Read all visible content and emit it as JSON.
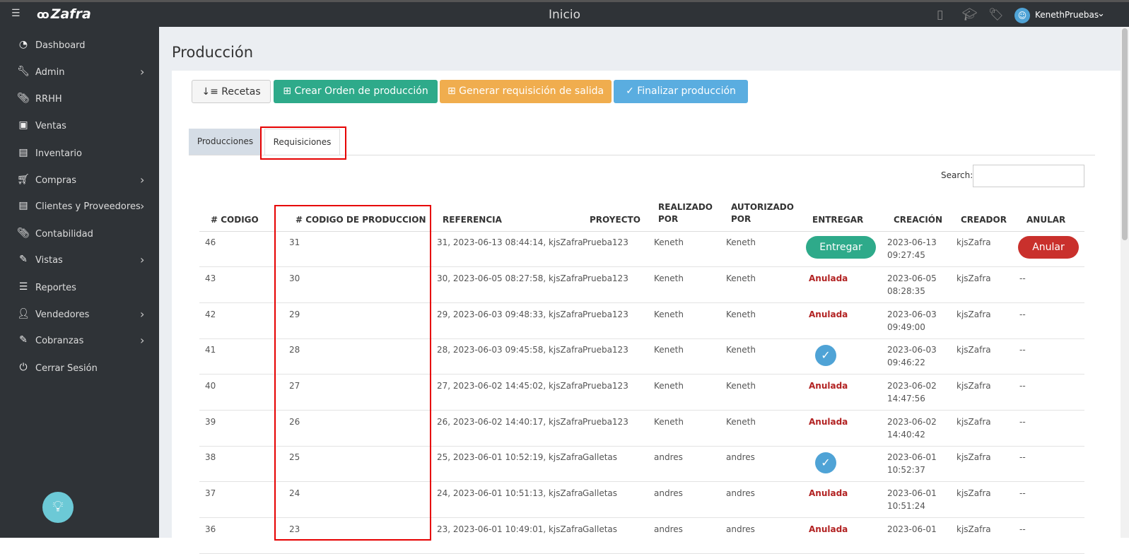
{
  "topbar": {
    "menu_icon": "menu-icon",
    "brand": "Zafra",
    "title": "Inicio",
    "icons": [
      "mobile-icon",
      "graduation-cap-icon",
      "tags-icon"
    ],
    "username": "KenethPruebas"
  },
  "sidebar": {
    "items": [
      {
        "label": "Dashboard",
        "icon": "dashboard-icon",
        "has_submenu": false
      },
      {
        "label": "Admin",
        "icon": "wrench-icon",
        "has_submenu": true
      },
      {
        "label": "RRHH",
        "icon": "paperclip-icon",
        "has_submenu": false
      },
      {
        "label": "Ventas",
        "icon": "money-icon",
        "has_submenu": false
      },
      {
        "label": "Inventario",
        "icon": "book-icon",
        "has_submenu": false
      },
      {
        "label": "Compras",
        "icon": "cart-icon",
        "has_submenu": true
      },
      {
        "label": "Clientes y Proveedores",
        "icon": "book-icon",
        "has_submenu": true
      },
      {
        "label": "Contabilidad",
        "icon": "paperclip-icon",
        "has_submenu": false
      },
      {
        "label": "Vistas",
        "icon": "edit-icon",
        "has_submenu": true
      },
      {
        "label": "Reportes",
        "icon": "list-icon",
        "has_submenu": false
      },
      {
        "label": "Vendedores",
        "icon": "user-icon",
        "has_submenu": true
      },
      {
        "label": "Cobranzas",
        "icon": "edit-icon",
        "has_submenu": true
      },
      {
        "label": "Cerrar Sesión",
        "icon": "power-icon",
        "has_submenu": false
      }
    ]
  },
  "page": {
    "title": "Producción"
  },
  "toolbar": {
    "recetas": "Recetas",
    "crear": "Crear Orden de producción",
    "generar": "Generar requisición de salida",
    "finalizar": "Finalizar producción"
  },
  "tabs": {
    "producciones": "Producciones",
    "requisiciones": "Requisiciones",
    "active": "Requisiciones"
  },
  "search": {
    "label": "Search:",
    "value": ""
  },
  "table": {
    "headers": {
      "codigo": "# CODIGO",
      "codigo_produccion": "# CODIGO DE PRODUCCION",
      "referencia": "REFERENCIA",
      "proyecto": "PROYECTO",
      "realizado_1": "REALIZADO",
      "realizado_2": "POR",
      "autorizado_1": "AUTORIZADO",
      "autorizado_2": "POR",
      "entregar": "ENTREGAR",
      "creacion": "CREACIÓN",
      "creador": "CREADOR",
      "anular": "ANULAR"
    },
    "rows": [
      {
        "codigo": "46",
        "cod_prod": "31",
        "referencia": "31, 2023-06-13 08:44:14, kjsZafra",
        "proyecto": "Prueba123",
        "realizado": "Keneth",
        "autorizado": "Keneth",
        "entregar_type": "button",
        "entregar": "Entregar",
        "fecha": "2023-06-13",
        "hora": "09:27:45",
        "creador": "kjsZafra",
        "anular_type": "button",
        "anular": "Anular"
      },
      {
        "codigo": "43",
        "cod_prod": "30",
        "referencia": "30, 2023-06-05 08:27:58, kjsZafra",
        "proyecto": "Prueba123",
        "realizado": "Keneth",
        "autorizado": "Keneth",
        "entregar_type": "text",
        "entregar": "Anulada",
        "fecha": "2023-06-05",
        "hora": "08:28:35",
        "creador": "kjsZafra",
        "anular_type": "text",
        "anular": "--"
      },
      {
        "codigo": "42",
        "cod_prod": "29",
        "referencia": "29, 2023-06-03 09:48:33, kjsZafra",
        "proyecto": "Prueba123",
        "realizado": "Keneth",
        "autorizado": "Keneth",
        "entregar_type": "text",
        "entregar": "Anulada",
        "fecha": "2023-06-03",
        "hora": "09:49:00",
        "creador": "kjsZafra",
        "anular_type": "text",
        "anular": "--"
      },
      {
        "codigo": "41",
        "cod_prod": "28",
        "referencia": "28, 2023-06-03 09:45:58, kjsZafra",
        "proyecto": "Prueba123",
        "realizado": "Keneth",
        "autorizado": "Keneth",
        "entregar_type": "check",
        "entregar": "",
        "fecha": "2023-06-03",
        "hora": "09:46:22",
        "creador": "kjsZafra",
        "anular_type": "text",
        "anular": "--"
      },
      {
        "codigo": "40",
        "cod_prod": "27",
        "referencia": "27, 2023-06-02 14:45:02, kjsZafra",
        "proyecto": "Prueba123",
        "realizado": "Keneth",
        "autorizado": "Keneth",
        "entregar_type": "text",
        "entregar": "Anulada",
        "fecha": "2023-06-02",
        "hora": "14:47:56",
        "creador": "kjsZafra",
        "anular_type": "text",
        "anular": "--"
      },
      {
        "codigo": "39",
        "cod_prod": "26",
        "referencia": "26, 2023-06-02 14:40:17, kjsZafra",
        "proyecto": "Prueba123",
        "realizado": "Keneth",
        "autorizado": "Keneth",
        "entregar_type": "text",
        "entregar": "Anulada",
        "fecha": "2023-06-02",
        "hora": "14:40:42",
        "creador": "kjsZafra",
        "anular_type": "text",
        "anular": "--"
      },
      {
        "codigo": "38",
        "cod_prod": "25",
        "referencia": "25, 2023-06-01 10:52:19, kjsZafra",
        "proyecto": "Galletas",
        "realizado": "andres",
        "autorizado": "andres",
        "entregar_type": "check",
        "entregar": "",
        "fecha": "2023-06-01",
        "hora": "10:52:37",
        "creador": "kjsZafra",
        "anular_type": "text",
        "anular": "--"
      },
      {
        "codigo": "37",
        "cod_prod": "24",
        "referencia": "24, 2023-06-01 10:51:13, kjsZafra",
        "proyecto": "Galletas",
        "realizado": "andres",
        "autorizado": "andres",
        "entregar_type": "text",
        "entregar": "Anulada",
        "fecha": "2023-06-01",
        "hora": "10:51:24",
        "creador": "kjsZafra",
        "anular_type": "text",
        "anular": "--"
      },
      {
        "codigo": "36",
        "cod_prod": "23",
        "referencia": "23, 2023-06-01 10:49:01, kjsZafra",
        "proyecto": "Galletas",
        "realizado": "andres",
        "autorizado": "andres",
        "entregar_type": "text",
        "entregar": "Anulada",
        "fecha": "2023-06-01",
        "hora": "",
        "creador": "kjsZafra",
        "anular_type": "text",
        "anular": "--"
      }
    ]
  },
  "colors": {
    "sidebar_bg": "#2f3337",
    "success": "#2eaa8a",
    "warning": "#f0ad4e",
    "info": "#5aade0",
    "danger": "#c9302c",
    "highlight": "#e60000"
  }
}
